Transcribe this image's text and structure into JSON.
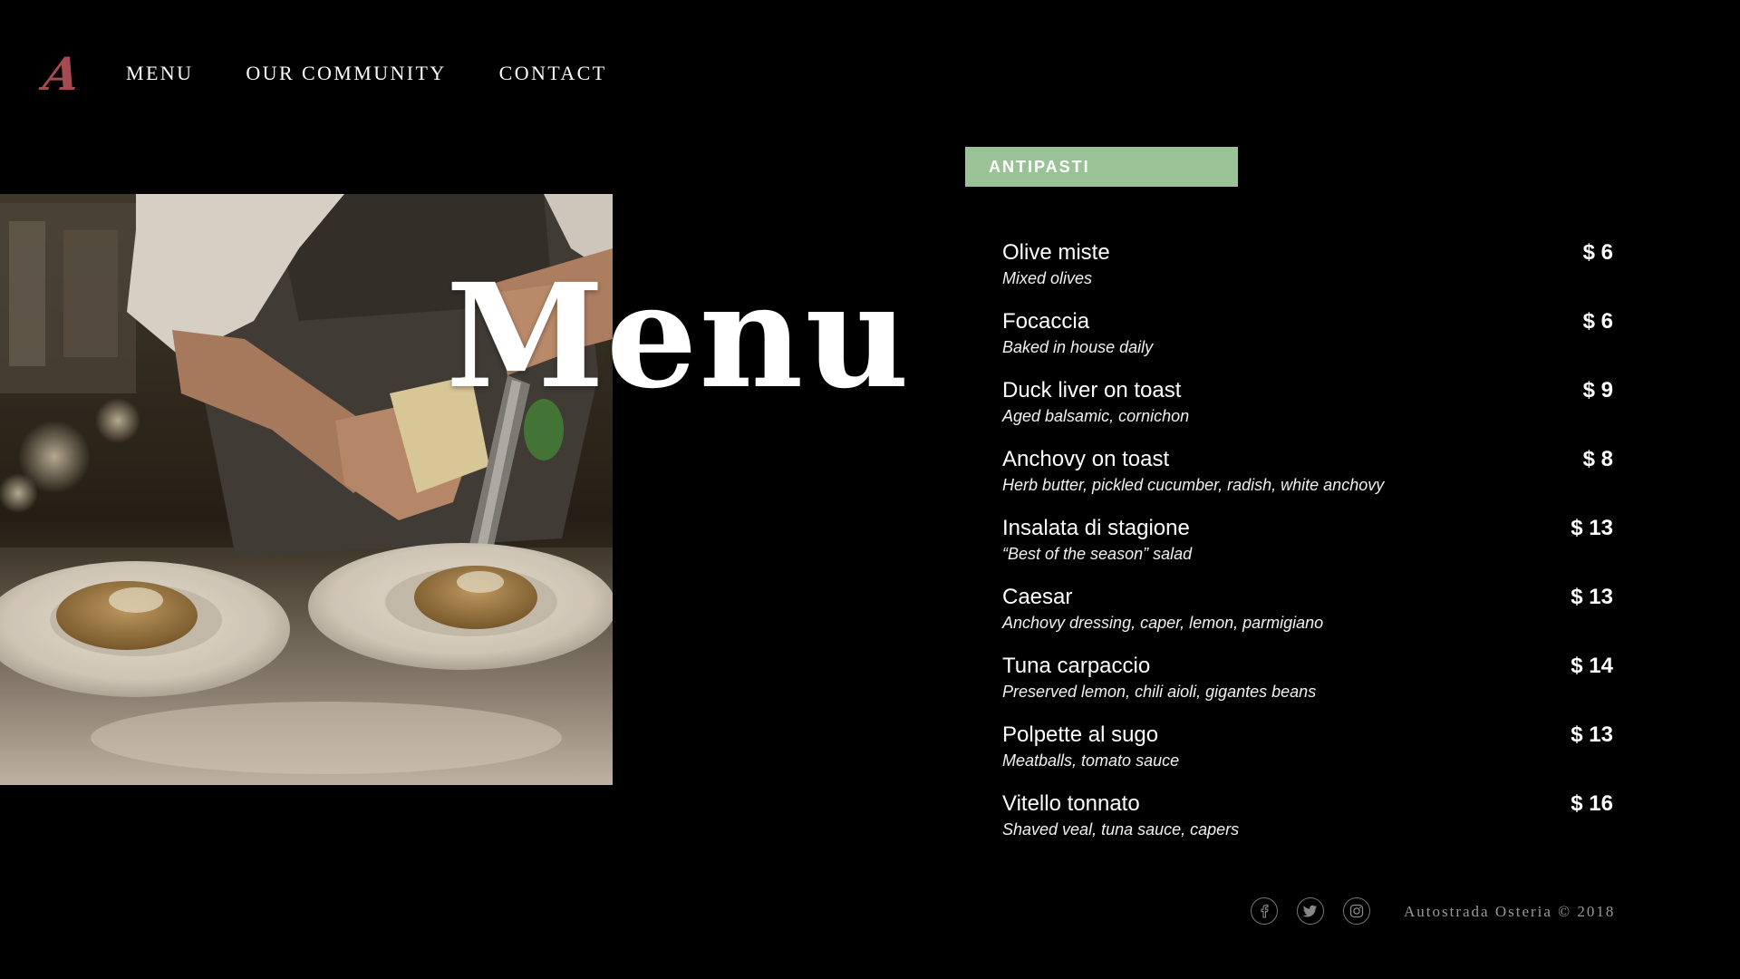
{
  "header": {
    "logo_letter": "A",
    "logo_color": "#a54a52",
    "nav": {
      "menu": "MENU",
      "community": "OUR COMMUNITY",
      "contact": "CONTACT"
    }
  },
  "hero": {
    "title": "Menu",
    "photo_subject": "chef grating cheese over two plates of pasta"
  },
  "menu": {
    "section_label": "ANTIPASTI",
    "section_color": "#9ac296",
    "items": [
      {
        "name": "Olive miste",
        "description": "Mixed olives",
        "price": "$ 6"
      },
      {
        "name": "Focaccia",
        "description": "Baked in house daily",
        "price": "$ 6"
      },
      {
        "name": "Duck liver on toast",
        "description": "Aged balsamic, cornichon",
        "price": "$ 9"
      },
      {
        "name": "Anchovy on toast",
        "description": "Herb butter, pickled cucumber, radish, white anchovy",
        "price": "$ 8"
      },
      {
        "name": "Insalata di stagione",
        "description": "“Best of the season” salad",
        "price": "$ 13"
      },
      {
        "name": "Caesar",
        "description": "Anchovy dressing, caper, lemon, parmigiano",
        "price": "$ 13"
      },
      {
        "name": "Tuna carpaccio",
        "description": "Preserved lemon, chili aioli, gigantes beans",
        "price": "$ 14"
      },
      {
        "name": "Polpette al sugo",
        "description": "Meatballs, tomato sauce",
        "price": "$ 13"
      },
      {
        "name": "Vitello tonnato",
        "description": "Shaved veal, tuna sauce, capers",
        "price": "$ 16"
      }
    ]
  },
  "footer": {
    "social_icons": [
      "facebook-icon",
      "twitter-icon",
      "instagram-icon"
    ],
    "copyright": "Autostrada Osteria © 2018"
  }
}
